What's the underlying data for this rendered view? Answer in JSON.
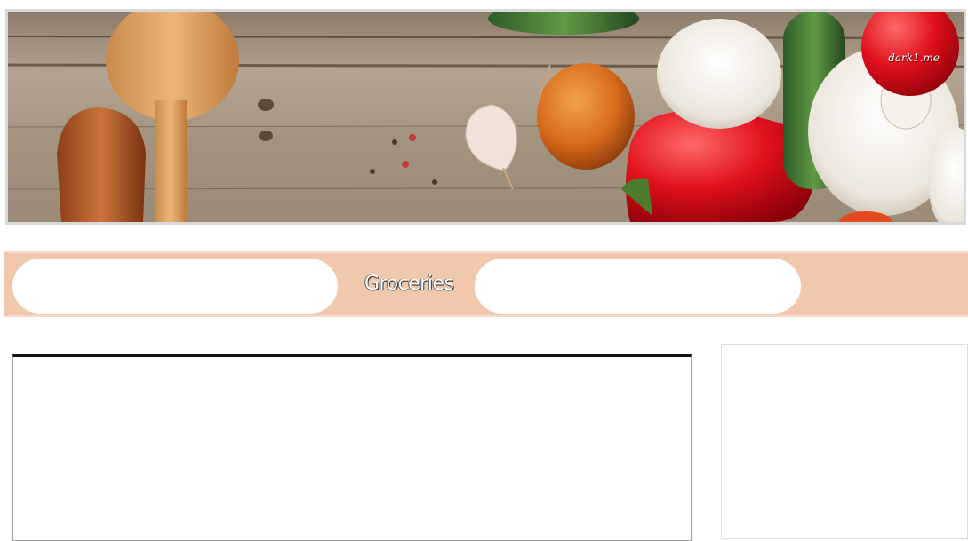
{
  "banner": {
    "watermark": "dark1.me"
  },
  "nav": {
    "center_label": "Groceries"
  }
}
